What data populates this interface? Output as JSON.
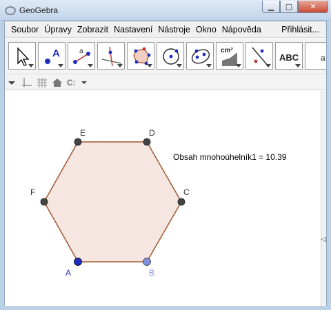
{
  "window": {
    "title": "GeoGebra"
  },
  "menu": {
    "items": [
      "Soubor",
      "Úpravy",
      "Zobrazit",
      "Nastavení",
      "Nástroje",
      "Okno",
      "Nápověda"
    ],
    "login": "Přihlásit..."
  },
  "toolbar": {
    "tools": [
      {
        "name": "move-tool"
      },
      {
        "name": "point-tool",
        "glyph": "A"
      },
      {
        "name": "segment-tool",
        "glyph": "a"
      },
      {
        "name": "perpendicular-tool"
      },
      {
        "name": "polygon-tool"
      },
      {
        "name": "circle-tool"
      },
      {
        "name": "ellipse-tool"
      },
      {
        "name": "area-tool",
        "glyph": "cm²"
      },
      {
        "name": "reflect-tool"
      },
      {
        "name": "text-tool",
        "glyph": "ABC"
      }
    ]
  },
  "stylebar": {
    "point_capture": "C:"
  },
  "graphics": {
    "area_text": "Obsah mnohoúhelník1 = 10.39",
    "points": [
      {
        "label": "A",
        "color": "#1f2ebf"
      },
      {
        "label": "B",
        "color": "#8090e0"
      },
      {
        "label": "C",
        "color": "#444444"
      },
      {
        "label": "D",
        "color": "#444444"
      },
      {
        "label": "E",
        "color": "#444444"
      },
      {
        "label": "F",
        "color": "#444444"
      }
    ],
    "polygon": {
      "fill": "#f5e6e1",
      "stroke": "#a4562e"
    }
  }
}
